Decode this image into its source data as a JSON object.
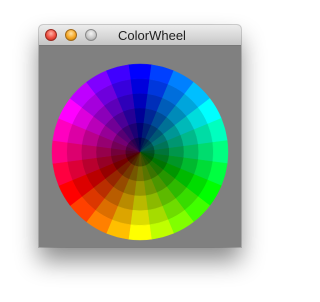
{
  "window": {
    "title": "ColorWheel",
    "background": "#808080"
  },
  "titlebar": {
    "close_icon": "close-icon",
    "minimize_icon": "minimize-icon",
    "zoom_icon": "zoom-icon"
  },
  "color_wheel": {
    "segments": 24,
    "rings": 6,
    "hue_at_top": "blue"
  }
}
